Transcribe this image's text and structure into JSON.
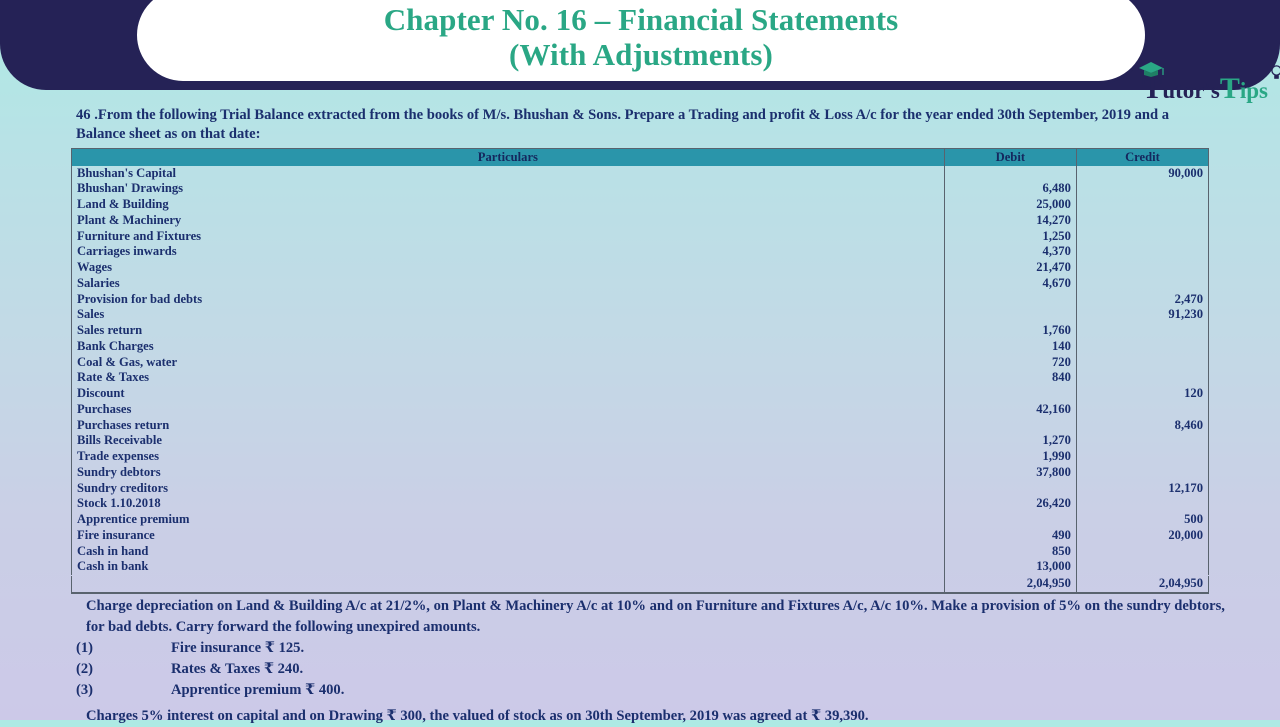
{
  "header": {
    "title_line1": "Chapter No. 16 – Financial Statements",
    "title_line2": "(With Adjustments)",
    "logo": {
      "t1": "T",
      "utor": "utor's",
      "t2": "T",
      "ips": "ips",
      "cap_icon": "graduation-cap-icon",
      "bulb_icon": "lightbulb-icon"
    },
    "banner_color": "#252256",
    "title_color": "#2aa785"
  },
  "question": {
    "text": "46 .From the following Trial Balance extracted from the books of M/s. Bhushan & Sons. Prepare a Trading and profit & Loss A/c for the year ended 30th September,  2019 and a Balance sheet as on that date:"
  },
  "table": {
    "header_color": "#2a95aa",
    "columns": [
      "Particulars",
      "Debit",
      "Credit"
    ],
    "rows": [
      {
        "particulars": "Bhushan's Capital",
        "debit": "",
        "credit": "90,000"
      },
      {
        "particulars": "Bhushan' Drawings",
        "debit": "6,480",
        "credit": ""
      },
      {
        "particulars": "Land & Building",
        "debit": "25,000",
        "credit": ""
      },
      {
        "particulars": "Plant & Machinery",
        "debit": "14,270",
        "credit": ""
      },
      {
        "particulars": "Furniture and  Fixtures",
        "debit": "1,250",
        "credit": ""
      },
      {
        "particulars": "Carriages inwards",
        "debit": "4,370",
        "credit": ""
      },
      {
        "particulars": "Wages",
        "debit": "21,470",
        "credit": ""
      },
      {
        "particulars": "Salaries",
        "debit": "4,670",
        "credit": ""
      },
      {
        "particulars": "Provision for bad debts",
        "debit": "",
        "credit": "2,470"
      },
      {
        "particulars": "Sales",
        "debit": "",
        "credit": "91,230"
      },
      {
        "particulars": "Sales return",
        "debit": "1,760",
        "credit": ""
      },
      {
        "particulars": "Bank Charges",
        "debit": "140",
        "credit": ""
      },
      {
        "particulars": "Coal & Gas, water",
        "debit": "720",
        "credit": ""
      },
      {
        "particulars": "Rate & Taxes",
        "debit": "840",
        "credit": ""
      },
      {
        "particulars": "Discount",
        "debit": "",
        "credit": "120"
      },
      {
        "particulars": "Purchases",
        "debit": "42,160",
        "credit": ""
      },
      {
        "particulars": "Purchases return",
        "debit": "",
        "credit": "8,460"
      },
      {
        "particulars": "Bills Receivable",
        "debit": "1,270",
        "credit": ""
      },
      {
        "particulars": "Trade expenses",
        "debit": "1,990",
        "credit": ""
      },
      {
        "particulars": "Sundry debtors",
        "debit": "37,800",
        "credit": ""
      },
      {
        "particulars": "Sundry creditors",
        "debit": "",
        "credit": "12,170"
      },
      {
        "particulars": "Stock 1.10.2018",
        "debit": "26,420",
        "credit": ""
      },
      {
        "particulars": "Apprentice premium",
        "debit": "",
        "credit": "500"
      },
      {
        "particulars": "Fire insurance",
        "debit": "490",
        "credit": "20,000"
      },
      {
        "particulars": "Cash in hand",
        "debit": "850",
        "credit": ""
      },
      {
        "particulars": "Cash in bank",
        "debit": "13,000",
        "credit": ""
      }
    ],
    "totals": {
      "particulars": "",
      "debit": "2,04,950",
      "credit": "2,04,950"
    }
  },
  "footer": {
    "adjustment_intro": "Charge depreciation on Land & Building A/c at 21/2%, on Plant & Machinery A/c at 10% and on Furniture and Fixtures A/c, A/c 10%. Make a provision of 5% on the sundry debtors, for bad debts. Carry forward the following unexpired amounts.",
    "items": [
      {
        "num": "(1)",
        "text": "Fire insurance ₹ 125."
      },
      {
        "num": "(2)",
        "text": "Rates & Taxes ₹ 240."
      },
      {
        "num": "(3)",
        "text": "Apprentice premium ₹ 400."
      }
    ],
    "closing_note": "Charges 5% interest on capital and on Drawing ₹ 300, the valued of stock as on 30th September,  2019  was agreed at ₹ 39,390."
  }
}
